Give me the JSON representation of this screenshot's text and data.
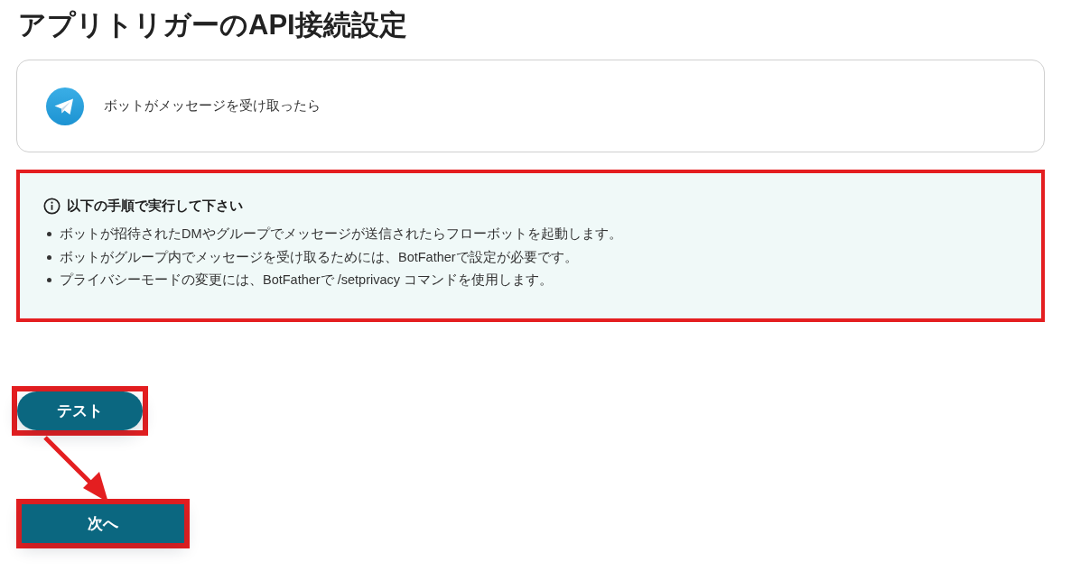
{
  "page": {
    "title": "アプリトリガーのAPI接続設定"
  },
  "trigger": {
    "label": "ボットがメッセージを受け取ったら"
  },
  "notice": {
    "title": "以下の手順で実行して下さい",
    "highlighted": true,
    "items": [
      "ボットが招待されたDMやグループでメッセージが送信されたらフローボットを起動します。",
      "ボットがグループ内でメッセージを受け取るためには、BotFatherで設定が必要です。",
      "プライバシーモードの変更には、BotFatherで /setprivacy コマンドを使用します。"
    ]
  },
  "buttons": [
    {
      "label": "テスト",
      "kind": "pill",
      "highlighted": true
    },
    {
      "label": "次へ",
      "kind": "block",
      "highlighted": true
    }
  ]
}
